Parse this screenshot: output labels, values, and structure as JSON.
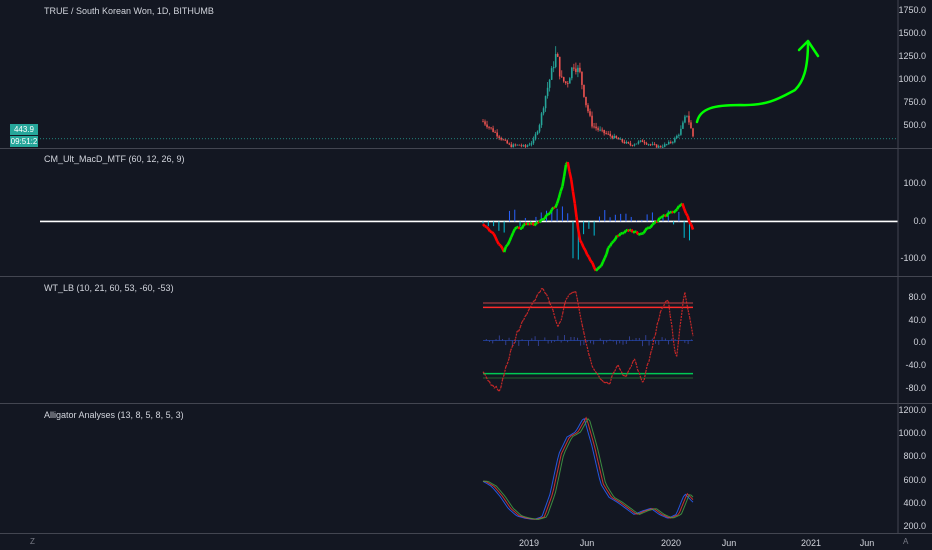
{
  "symbol_title": "TRUE / South Korean Won, 1D, BITHUMB",
  "price_badge": "443.9",
  "time_badge": "09:51:2",
  "corner_left": "Z",
  "corner_right": "A",
  "colors": {
    "background": "#131722",
    "up": "#26a69a",
    "down": "#ef5350",
    "macd_up": "#00e600",
    "macd_down": "#ff0000",
    "arrow": "#00ff00"
  },
  "chart_data": [
    {
      "type": "candlestick",
      "title": "TRUE / South Korean Won, 1D, BITHUMB",
      "y_ticks": [
        "1750.0",
        "1500.0",
        "1250.0",
        "1000.0",
        "750.0",
        "500.0"
      ],
      "ylim": [
        350,
        1750
      ],
      "x_ticks": [
        "2019",
        "Jun",
        "2020",
        "Jun",
        "2021",
        "Jun"
      ],
      "series": [
        {
          "values": [
            [
              0.0,
              620
            ],
            [
              0.03,
              560
            ],
            [
              0.06,
              500
            ],
            [
              0.1,
              420
            ],
            [
              0.13,
              370
            ],
            [
              0.17,
              380
            ],
            [
              0.2,
              360
            ],
            [
              0.24,
              420
            ],
            [
              0.27,
              600
            ],
            [
              0.3,
              900
            ],
            [
              0.33,
              1150
            ],
            [
              0.35,
              1320
            ],
            [
              0.37,
              1050
            ],
            [
              0.4,
              1000
            ],
            [
              0.43,
              1200
            ],
            [
              0.46,
              1120
            ],
            [
              0.49,
              800
            ],
            [
              0.52,
              580
            ],
            [
              0.56,
              520
            ],
            [
              0.6,
              480
            ],
            [
              0.63,
              450
            ],
            [
              0.66,
              420
            ],
            [
              0.7,
              380
            ],
            [
              0.73,
              400
            ],
            [
              0.76,
              420
            ],
            [
              0.8,
              380
            ],
            [
              0.84,
              360
            ],
            [
              0.88,
              390
            ],
            [
              0.91,
              430
            ],
            [
              0.94,
              520
            ],
            [
              0.97,
              700
            ],
            [
              1.0,
              470
            ]
          ]
        }
      ],
      "last_price": 443.9,
      "annotation": "hand-drawn upward arrow projection"
    },
    {
      "type": "line",
      "title": "CM_Ult_MacD_MTF (60, 12, 26, 9)",
      "y_ticks": [
        "100.0",
        "0.0",
        "-100.0"
      ],
      "ylim": [
        -130,
        170
      ],
      "series": [
        {
          "values": [
            [
              0.0,
              -5
            ],
            [
              0.05,
              -30
            ],
            [
              0.1,
              -70
            ],
            [
              0.15,
              -20
            ],
            [
              0.2,
              -10
            ],
            [
              0.25,
              -5
            ],
            [
              0.3,
              10
            ],
            [
              0.35,
              40
            ],
            [
              0.38,
              90
            ],
            [
              0.4,
              150
            ],
            [
              0.43,
              70
            ],
            [
              0.46,
              -40
            ],
            [
              0.5,
              -80
            ],
            [
              0.54,
              -120
            ],
            [
              0.57,
              -100
            ],
            [
              0.6,
              -60
            ],
            [
              0.65,
              -30
            ],
            [
              0.7,
              -20
            ],
            [
              0.75,
              -30
            ],
            [
              0.8,
              -10
            ],
            [
              0.85,
              10
            ],
            [
              0.9,
              20
            ],
            [
              0.95,
              40
            ],
            [
              1.0,
              -20
            ]
          ]
        }
      ]
    },
    {
      "type": "line",
      "title": "WT_LB (10, 21, 60, 53, -60, -53)",
      "y_ticks": [
        "80.0",
        "40.0",
        "0.0",
        "-40.0",
        "-80.0"
      ],
      "ylim": [
        -100,
        100
      ],
      "levels": [
        53,
        60,
        -53,
        -60
      ],
      "series": [
        {
          "values": [
            [
              0.0,
              -50
            ],
            [
              0.04,
              -70
            ],
            [
              0.08,
              -80
            ],
            [
              0.12,
              -30
            ],
            [
              0.16,
              10
            ],
            [
              0.2,
              40
            ],
            [
              0.24,
              60
            ],
            [
              0.28,
              85
            ],
            [
              0.32,
              60
            ],
            [
              0.36,
              20
            ],
            [
              0.4,
              70
            ],
            [
              0.44,
              80
            ],
            [
              0.48,
              10
            ],
            [
              0.52,
              -40
            ],
            [
              0.56,
              -60
            ],
            [
              0.6,
              -70
            ],
            [
              0.64,
              -40
            ],
            [
              0.68,
              -60
            ],
            [
              0.72,
              -30
            ],
            [
              0.76,
              -70
            ],
            [
              0.8,
              -20
            ],
            [
              0.84,
              40
            ],
            [
              0.88,
              70
            ],
            [
              0.92,
              -30
            ],
            [
              0.96,
              80
            ],
            [
              1.0,
              10
            ]
          ]
        }
      ]
    },
    {
      "type": "line",
      "title": "Alligator Analyses (13, 8, 5, 8, 5, 3)",
      "y_ticks": [
        "1200.0",
        "1000.0",
        "800.0",
        "600.0",
        "400.0",
        "200.0"
      ],
      "ylim": [
        180,
        1220
      ],
      "series": [
        {
          "values": [
            [
              0.0,
              600
            ],
            [
              0.04,
              560
            ],
            [
              0.08,
              480
            ],
            [
              0.12,
              380
            ],
            [
              0.16,
              320
            ],
            [
              0.2,
              300
            ],
            [
              0.24,
              290
            ],
            [
              0.28,
              310
            ],
            [
              0.32,
              500
            ],
            [
              0.36,
              820
            ],
            [
              0.4,
              960
            ],
            [
              0.44,
              1000
            ],
            [
              0.48,
              1120
            ],
            [
              0.52,
              880
            ],
            [
              0.56,
              580
            ],
            [
              0.6,
              470
            ],
            [
              0.64,
              430
            ],
            [
              0.68,
              380
            ],
            [
              0.72,
              330
            ],
            [
              0.76,
              360
            ],
            [
              0.8,
              380
            ],
            [
              0.84,
              330
            ],
            [
              0.88,
              300
            ],
            [
              0.92,
              330
            ],
            [
              0.96,
              500
            ],
            [
              1.0,
              430
            ]
          ]
        }
      ]
    }
  ]
}
